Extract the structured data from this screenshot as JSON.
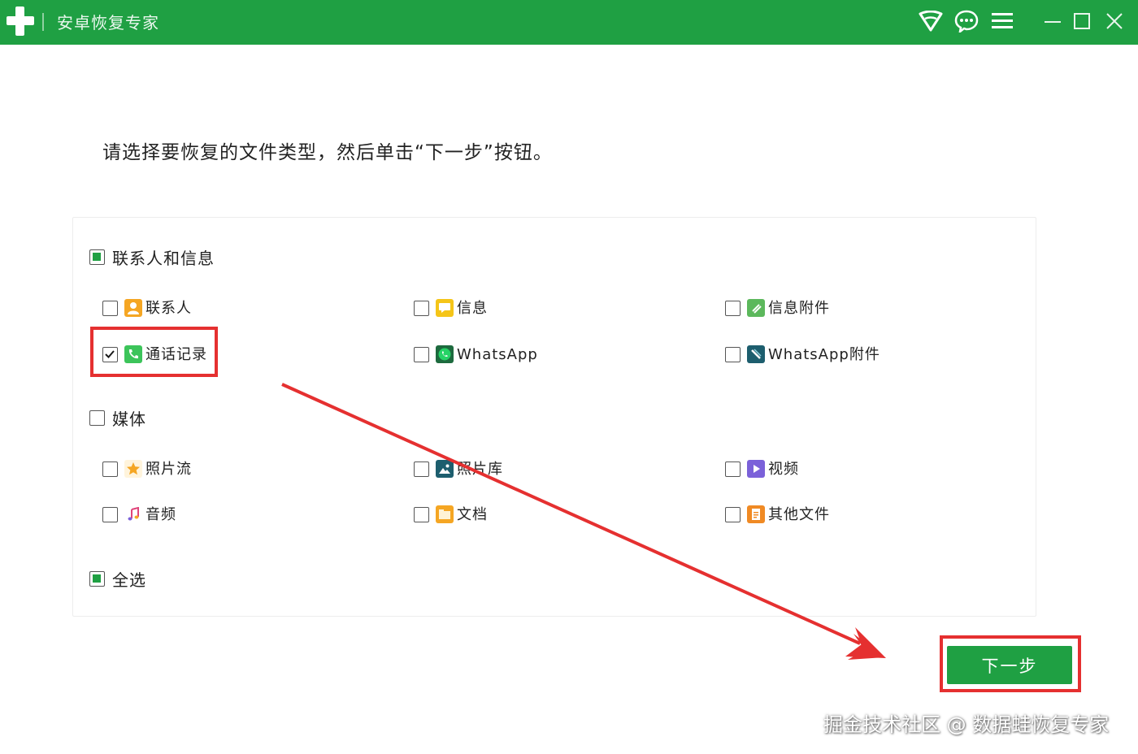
{
  "window": {
    "title": "安卓恢复专家",
    "icons": [
      "wifi-icon",
      "chat-icon",
      "menu-icon",
      "minimize-icon",
      "maximize-icon",
      "close-icon"
    ]
  },
  "instruction": "请选择要恢复的文件类型，然后单击“下一步”按钮。",
  "groups": {
    "contacts_messages": {
      "label": "联系人和信息",
      "state": "partial",
      "items": {
        "contacts": {
          "label": "联系人",
          "checked": false,
          "icon": "contact-icon",
          "color": "#f5a623"
        },
        "messages": {
          "label": "信息",
          "checked": false,
          "icon": "message-icon",
          "color": "#f5c518"
        },
        "message_attachments": {
          "label": "信息附件",
          "checked": false,
          "icon": "attachment-icon",
          "color": "#5cb85c"
        },
        "call_logs": {
          "label": "通话记录",
          "checked": true,
          "icon": "phone-icon",
          "color": "#3cc45a"
        },
        "whatsapp": {
          "label": "WhatsApp",
          "checked": false,
          "icon": "whatsapp-icon",
          "color": "#26b35a"
        },
        "whatsapp_attachments": {
          "label": "WhatsApp附件",
          "checked": false,
          "icon": "whatsapp-attachment-icon",
          "color": "#1d5e6e"
        }
      }
    },
    "media": {
      "label": "媒体",
      "state": "unchecked",
      "items": {
        "photo_stream": {
          "label": "照片流",
          "checked": false,
          "icon": "star-icon",
          "color": "#f5a623"
        },
        "photo_library": {
          "label": "照片库",
          "checked": false,
          "icon": "picture-icon",
          "color": "#1d5e6e"
        },
        "videos": {
          "label": "视频",
          "checked": false,
          "icon": "video-icon",
          "color": "#7b61d9"
        },
        "audio": {
          "label": "音频",
          "checked": false,
          "icon": "music-icon",
          "color": "#e0447a"
        },
        "documents": {
          "label": "文档",
          "checked": false,
          "icon": "folder-icon",
          "color": "#f5a623"
        },
        "other_files": {
          "label": "其他文件",
          "checked": false,
          "icon": "file-icon",
          "color": "#f08a24"
        }
      }
    }
  },
  "select_all": {
    "label": "全选",
    "state": "partial"
  },
  "next_button": {
    "label": "下一步"
  },
  "watermark": "掘金技术社区 @ 数据蛙恢复专家",
  "colors": {
    "brand": "#1fa043",
    "highlight": "#e53030"
  }
}
